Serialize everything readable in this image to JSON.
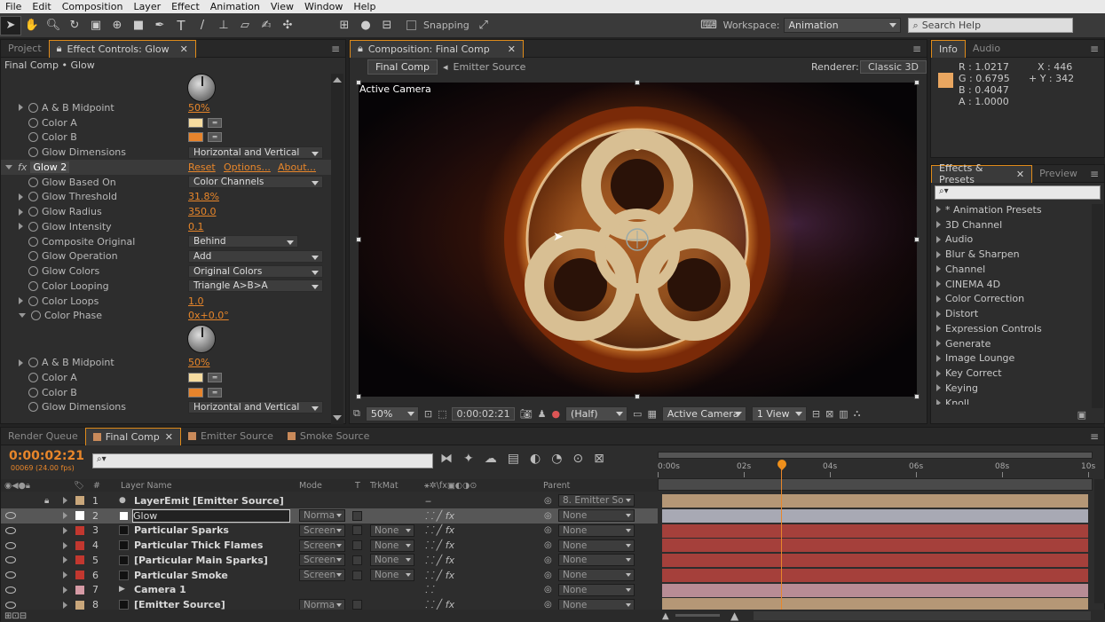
{
  "menu": [
    "File",
    "Edit",
    "Composition",
    "Layer",
    "Effect",
    "Animation",
    "View",
    "Window",
    "Help"
  ],
  "toolbar": {
    "snapping_label": "Snapping",
    "workspace_label": "Workspace:",
    "workspace_value": "Animation",
    "search_placeholder": "Search Help"
  },
  "left_panel": {
    "tabs": [
      "Project",
      "Effect Controls: Glow"
    ],
    "breadcrumb": "Final Comp • Glow",
    "rows_a": [
      {
        "name": "A & B Midpoint",
        "value": "50%",
        "kind": "val",
        "expand": "right"
      },
      {
        "name": "Color A",
        "kind": "color",
        "color": "#f6dca0"
      },
      {
        "name": "Color B",
        "kind": "color",
        "color": "#e7842c"
      },
      {
        "name": "Glow Dimensions",
        "kind": "dd",
        "value": "Horizontal and Vertical"
      }
    ],
    "glow2": {
      "label": "Glow 2",
      "reset": "Reset",
      "options": "Options...",
      "about": "About..."
    },
    "rows_b": [
      {
        "name": "Glow Based On",
        "kind": "dd",
        "value": "Color Channels",
        "expand": "none"
      },
      {
        "name": "Glow Threshold",
        "kind": "val",
        "value": "31.8%",
        "expand": "right"
      },
      {
        "name": "Glow Radius",
        "kind": "val",
        "value": "350.0",
        "expand": "right"
      },
      {
        "name": "Glow Intensity",
        "kind": "val",
        "value": "0.1",
        "expand": "right"
      },
      {
        "name": "Composite Original",
        "kind": "dd",
        "value": "Behind",
        "expand": "none"
      },
      {
        "name": "Glow Operation",
        "kind": "dd",
        "value": "Add",
        "expand": "none"
      },
      {
        "name": "Glow Colors",
        "kind": "dd",
        "value": "Original Colors",
        "expand": "none"
      },
      {
        "name": "Color Looping",
        "kind": "dd",
        "value": "Triangle A>B>A",
        "expand": "none"
      },
      {
        "name": "Color Loops",
        "kind": "val",
        "value": "1.0",
        "expand": "right"
      },
      {
        "name": "Color Phase",
        "kind": "val",
        "value": "0x+0.0°",
        "expand": "down"
      }
    ],
    "rows_c": [
      {
        "name": "A & B Midpoint",
        "value": "50%",
        "kind": "val",
        "expand": "right"
      },
      {
        "name": "Color A",
        "kind": "color",
        "color": "#f6dca0"
      },
      {
        "name": "Color B",
        "kind": "color",
        "color": "#e7842c"
      },
      {
        "name": "Glow Dimensions",
        "kind": "dd",
        "value": "Horizontal and Vertical"
      }
    ]
  },
  "comp_panel": {
    "tab": "Composition: Final Comp",
    "crumbs": [
      "Final Comp",
      "Emitter Source"
    ],
    "renderer_label": "Renderer:",
    "renderer_value": "Classic 3D",
    "view_label": "Active Camera",
    "footer": {
      "zoom": "50%",
      "time": "0:00:02:21",
      "res": "(Half)",
      "camera": "Active Camera",
      "views": "1 View"
    }
  },
  "info_panel": {
    "tabs": [
      "Info",
      "Audio"
    ],
    "r": "R : 1.0217",
    "g": "G : 0.6795",
    "b": "B : 0.4047",
    "a": "A : 1.0000",
    "x": "X : 446",
    "y": "+ Y : 342",
    "swatch": "#e9a660"
  },
  "effects_panel": {
    "tabs": [
      "Effects & Presets",
      "Preview"
    ],
    "search_placeholder": "⌕▾",
    "items": [
      "* Animation Presets",
      "3D Channel",
      "Audio",
      "Blur & Sharpen",
      "Channel",
      "CINEMA 4D",
      "Color Correction",
      "Distort",
      "Expression Controls",
      "Generate",
      "Image Lounge",
      "Key Correct",
      "Keying",
      "Knoll"
    ]
  },
  "timeline": {
    "tabs": [
      "Render Queue",
      "Final Comp",
      "Emitter Source",
      "Smoke Source"
    ],
    "timecode": "0:00:02:21",
    "frames": "00069 (24.00 fps)",
    "headers": {
      "layer": "Layer Name",
      "mode": "Mode",
      "t": "T",
      "trkmat": "TrkMat",
      "parent": "Parent"
    },
    "ruler": [
      "0:00s",
      "02s",
      "04s",
      "06s",
      "08s",
      "10s"
    ],
    "playhead_time_s": 2.875,
    "layers": [
      {
        "num": "1",
        "name": "LayerEmit [Emitter Source]",
        "mode": "",
        "trk": "",
        "parent": "8. Emitter So",
        "color": "#c9a77b",
        "bar": "#b59776"
      },
      {
        "num": "2",
        "name": "Glow",
        "mode": "Norma",
        "trk": "",
        "parent": "None",
        "color": "#ffffff",
        "bar": "#a8a9b4",
        "selected": true
      },
      {
        "num": "3",
        "name": "Particular Sparks",
        "mode": "Screen",
        "trk": "None",
        "parent": "None",
        "color": "#c2372f",
        "bar": "#a5403b"
      },
      {
        "num": "4",
        "name": "Particular Thick Flames",
        "mode": "Screen",
        "trk": "None",
        "parent": "None",
        "color": "#c2372f",
        "bar": "#a5403b"
      },
      {
        "num": "5",
        "name": "[Particular Main Sparks]",
        "mode": "Screen",
        "trk": "None",
        "parent": "None",
        "color": "#c2372f",
        "bar": "#a5403b"
      },
      {
        "num": "6",
        "name": "Particular Smoke",
        "mode": "Screen",
        "trk": "None",
        "parent": "None",
        "color": "#c2372f",
        "bar": "#a5403b"
      },
      {
        "num": "7",
        "name": "Camera 1",
        "mode": "",
        "trk": "",
        "parent": "None",
        "color": "#d59aa5",
        "bar": "#b88c95"
      },
      {
        "num": "8",
        "name": "[Emitter Source]",
        "mode": "Norma",
        "trk": "",
        "parent": "None",
        "color": "#c9a77b",
        "bar": "#b59776"
      }
    ]
  }
}
